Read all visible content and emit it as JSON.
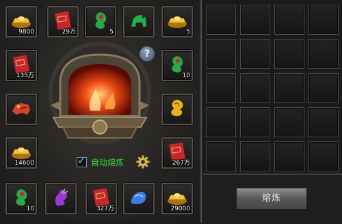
{
  "slots": [
    {
      "item": "gold-ingot",
      "qty": "9800"
    },
    {
      "item": "red-scroll",
      "qty": "29万"
    },
    {
      "item": "jade-dragon",
      "qty": "5"
    },
    {
      "item": "jade-beast",
      "qty": ""
    },
    {
      "item": "gold-ingot",
      "qty": "5"
    },
    {
      "item": "red-scroll",
      "qty": "135万"
    },
    {
      "item": "jade-dragon",
      "qty": "10"
    },
    {
      "item": "red-tiger",
      "qty": ""
    },
    {
      "item": "gold-dragon",
      "qty": ""
    },
    {
      "item": "gold-ingot",
      "qty": "14600"
    },
    {
      "item": "red-scroll",
      "qty": "267万"
    },
    {
      "item": "jade-dragon",
      "qty": "10"
    },
    {
      "item": "purple-dragon",
      "qty": ""
    },
    {
      "item": "red-scroll",
      "qty": "327万"
    },
    {
      "item": "blue-dragon",
      "qty": ""
    },
    {
      "item": "gold-ingot",
      "qty": "29000"
    }
  ],
  "help": {
    "glyph": "?"
  },
  "auto_smelt": {
    "label": "自动熔炼",
    "checked": true,
    "check_glyph": "✓"
  },
  "smelt_button": {
    "label": "熔炼"
  },
  "colors": {
    "gold": "#e8b21e",
    "red": "#c8262a",
    "jade": "#2aa84a",
    "purple": "#9b3ad0",
    "blue": "#3b7de0",
    "label_green": "#39d33c"
  }
}
